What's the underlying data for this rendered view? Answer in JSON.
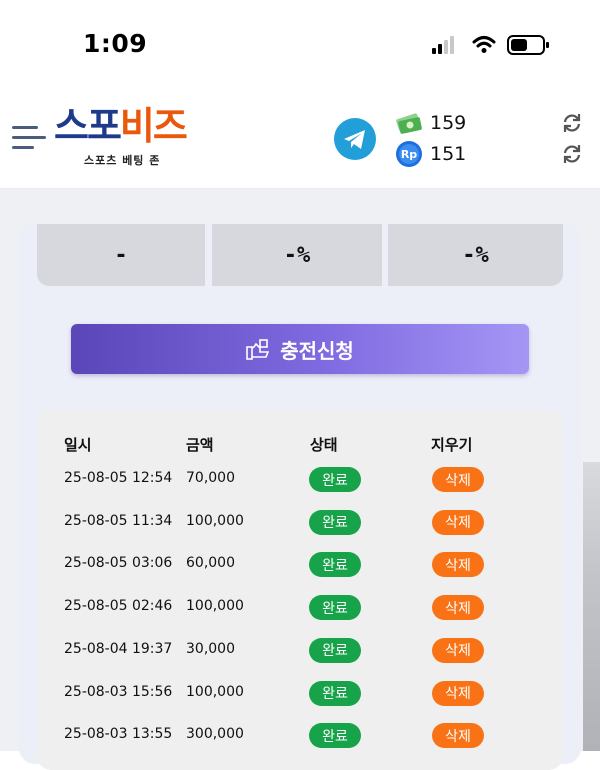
{
  "status_bar": {
    "time": "1:09"
  },
  "header": {
    "logo": {
      "main_part1": "스포",
      "main_part2": "비즈",
      "sub": "스포츠 베팅 존"
    },
    "balances": [
      {
        "icon": "cash-icon",
        "value": "159"
      },
      {
        "icon": "rp-icon",
        "value": "151"
      }
    ]
  },
  "stats": [
    "-",
    "-%",
    "-%"
  ],
  "charge_button": {
    "label": "충전신청"
  },
  "table": {
    "headers": {
      "date": "일시",
      "amount": "금액",
      "status": "상태",
      "delete": "지우기"
    },
    "rows": [
      {
        "date": "25-08-05 12:54",
        "amount": "70,000",
        "status": "완료",
        "delete": "삭제"
      },
      {
        "date": "25-08-05 11:34",
        "amount": "100,000",
        "status": "완료",
        "delete": "삭제"
      },
      {
        "date": "25-08-05 03:06",
        "amount": "60,000",
        "status": "완료",
        "delete": "삭제"
      },
      {
        "date": "25-08-05 02:46",
        "amount": "100,000",
        "status": "완료",
        "delete": "삭제"
      },
      {
        "date": "25-08-04 19:37",
        "amount": "30,000",
        "status": "완료",
        "delete": "삭제"
      },
      {
        "date": "25-08-03 15:56",
        "amount": "100,000",
        "status": "완료",
        "delete": "삭제"
      },
      {
        "date": "25-08-03 13:55",
        "amount": "300,000",
        "status": "완료",
        "delete": "삭제"
      }
    ]
  },
  "colors": {
    "accent_purple": "#6b57d0",
    "done_green": "#16a34a",
    "delete_orange": "#f97316",
    "telegram_blue": "#229ED9"
  }
}
